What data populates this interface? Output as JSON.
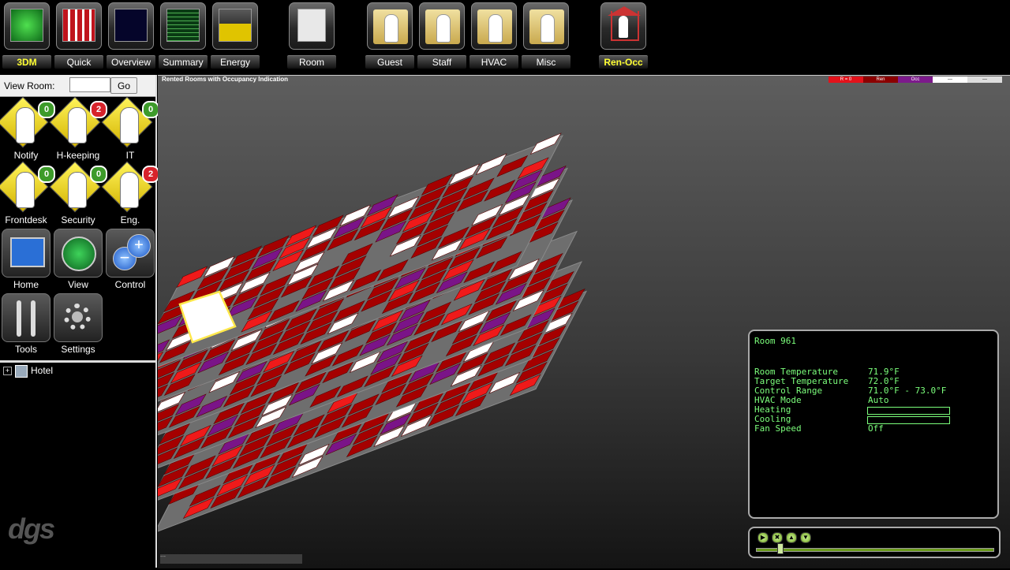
{
  "toolbar": {
    "buttons": [
      {
        "id": "3dm",
        "label": "3DM",
        "active": true
      },
      {
        "id": "quick",
        "label": "Quick",
        "active": false
      },
      {
        "id": "overview",
        "label": "Overview",
        "active": false
      },
      {
        "id": "summary",
        "label": "Summary",
        "active": false
      },
      {
        "id": "energy",
        "label": "Energy",
        "active": false
      },
      {
        "id": "room",
        "label": "Room",
        "active": false
      },
      {
        "id": "guest",
        "label": "Guest",
        "active": false
      },
      {
        "id": "staff",
        "label": "Staff",
        "active": false
      },
      {
        "id": "hvac",
        "label": "HVAC",
        "active": false
      },
      {
        "id": "misc",
        "label": "Misc",
        "active": false
      },
      {
        "id": "renocc",
        "label": "Ren-Occ",
        "active": true
      }
    ]
  },
  "left_panel": {
    "view_room_label": "View Room:",
    "view_room_value": "",
    "go_label": "Go",
    "staff_buttons": [
      {
        "label": "Notify",
        "count": "0",
        "badge": "green"
      },
      {
        "label": "H-keeping",
        "count": "2",
        "badge": "red"
      },
      {
        "label": "IT",
        "count": "0",
        "badge": "green"
      },
      {
        "label": "Frontdesk",
        "count": "0",
        "badge": "green"
      },
      {
        "label": "Security",
        "count": "0",
        "badge": "green"
      },
      {
        "label": "Eng.",
        "count": "2",
        "badge": "red"
      }
    ],
    "nav_buttons": [
      {
        "label": "Home",
        "icon": "home-screen-icon"
      },
      {
        "label": "View",
        "icon": "radar-view-icon"
      },
      {
        "label": "Control",
        "icon": "plus-minus-control-icon"
      },
      {
        "label": "Tools",
        "icon": "wrench-screwdriver-icon"
      },
      {
        "label": "Settings",
        "icon": "gear-icon"
      }
    ],
    "tree": {
      "expander": "+",
      "root_label": "Hotel"
    },
    "logo_text": "dgs"
  },
  "main_view": {
    "title": "Rented Rooms with Occupancy Indication",
    "legend": [
      {
        "label": "R = 0",
        "color": "#e3121b"
      },
      {
        "label": "Ren",
        "color": "#8b0000"
      },
      {
        "label": "Occ",
        "color": "#7d1a8c"
      },
      {
        "label": "---",
        "color": "#ffffff"
      },
      {
        "label": "---",
        "color": "#dddddd"
      }
    ],
    "status_text": "---",
    "colors": {
      "rented": "#a50000",
      "unrented": "#ef1a1a",
      "occupied": "#7a1488",
      "vacant": "#ffffff",
      "slab": "#6e6e6e",
      "selected_outline": "#ffe84a"
    }
  },
  "room_info": {
    "title": "Room 961",
    "rows": [
      {
        "label": "Room Temperature",
        "value": "71.9°F"
      },
      {
        "label": "Target Temperature",
        "value": "72.0°F"
      },
      {
        "label": "Control Range",
        "value": "71.0°F - 73.0°F"
      },
      {
        "label": "HVAC Mode",
        "value": "Auto"
      },
      {
        "label": "Heating",
        "value": ""
      },
      {
        "label": "Cooling",
        "value": ""
      },
      {
        "label": "Fan Speed",
        "value": "Off"
      }
    ],
    "heating_level": 0,
    "cooling_level": 0
  },
  "playback": {
    "buttons": [
      {
        "icon": "play-icon",
        "glyph": "▶"
      },
      {
        "icon": "stop-icon",
        "glyph": "✖"
      },
      {
        "icon": "up-icon",
        "glyph": "▲"
      },
      {
        "icon": "down-icon",
        "glyph": "▼"
      }
    ],
    "position": 0.09
  }
}
